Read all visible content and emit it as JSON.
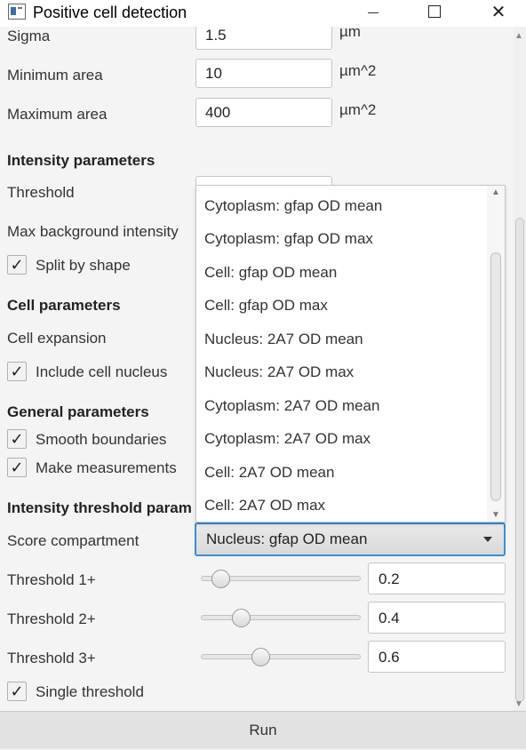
{
  "window": {
    "title": "Positive cell detection"
  },
  "icons": {
    "app": "app-window-icon",
    "minimize": "minimize-icon",
    "maximize": "maximize-icon",
    "close": "close-icon",
    "check": "checkmark-icon",
    "dropdown": "chevron-down-icon"
  },
  "fields": {
    "sigma": {
      "label": "Sigma",
      "value": "1.5",
      "unit": "µm"
    },
    "min_area": {
      "label": "Minimum area",
      "value": "10",
      "unit": "µm^2"
    },
    "max_area": {
      "label": "Maximum area",
      "value": "400",
      "unit": "µm^2"
    }
  },
  "intensity": {
    "header": "Intensity parameters",
    "threshold_label": "Threshold",
    "max_bg_label": "Max background intensity",
    "split_label": "Split by shape",
    "split_checked": true
  },
  "cell": {
    "header": "Cell parameters",
    "expansion_label": "Cell expansion",
    "include_nucleus_label": "Include cell nucleus",
    "include_nucleus_checked": true
  },
  "general": {
    "header": "General parameters",
    "smooth_label": "Smooth boundaries",
    "smooth_checked": true,
    "measure_label": "Make measurements",
    "measure_checked": true
  },
  "threshold_params": {
    "header": "Intensity threshold param",
    "score_label": "Score compartment",
    "score_value": "Nucleus: gfap OD mean",
    "options": [
      "Cytoplasm: gfap OD mean",
      "Cytoplasm: gfap OD max",
      "Cell: gfap OD mean",
      "Cell: gfap OD max",
      "Nucleus: 2A7 OD mean",
      "Nucleus: 2A7 OD max",
      "Cytoplasm: 2A7 OD mean",
      "Cytoplasm: 2A7 OD max",
      "Cell: 2A7 OD mean",
      "Cell: 2A7 OD max"
    ],
    "t1_label": "Threshold 1+",
    "t1_value": "0.2",
    "t1_slider": 0.2,
    "t2_label": "Threshold 2+",
    "t2_value": "0.4",
    "t2_slider": 0.4,
    "t3_label": "Threshold 3+",
    "t3_value": "0.6",
    "t3_slider": 0.6,
    "single_label": "Single threshold",
    "single_checked": true
  },
  "footer": {
    "run_label": "Run"
  }
}
